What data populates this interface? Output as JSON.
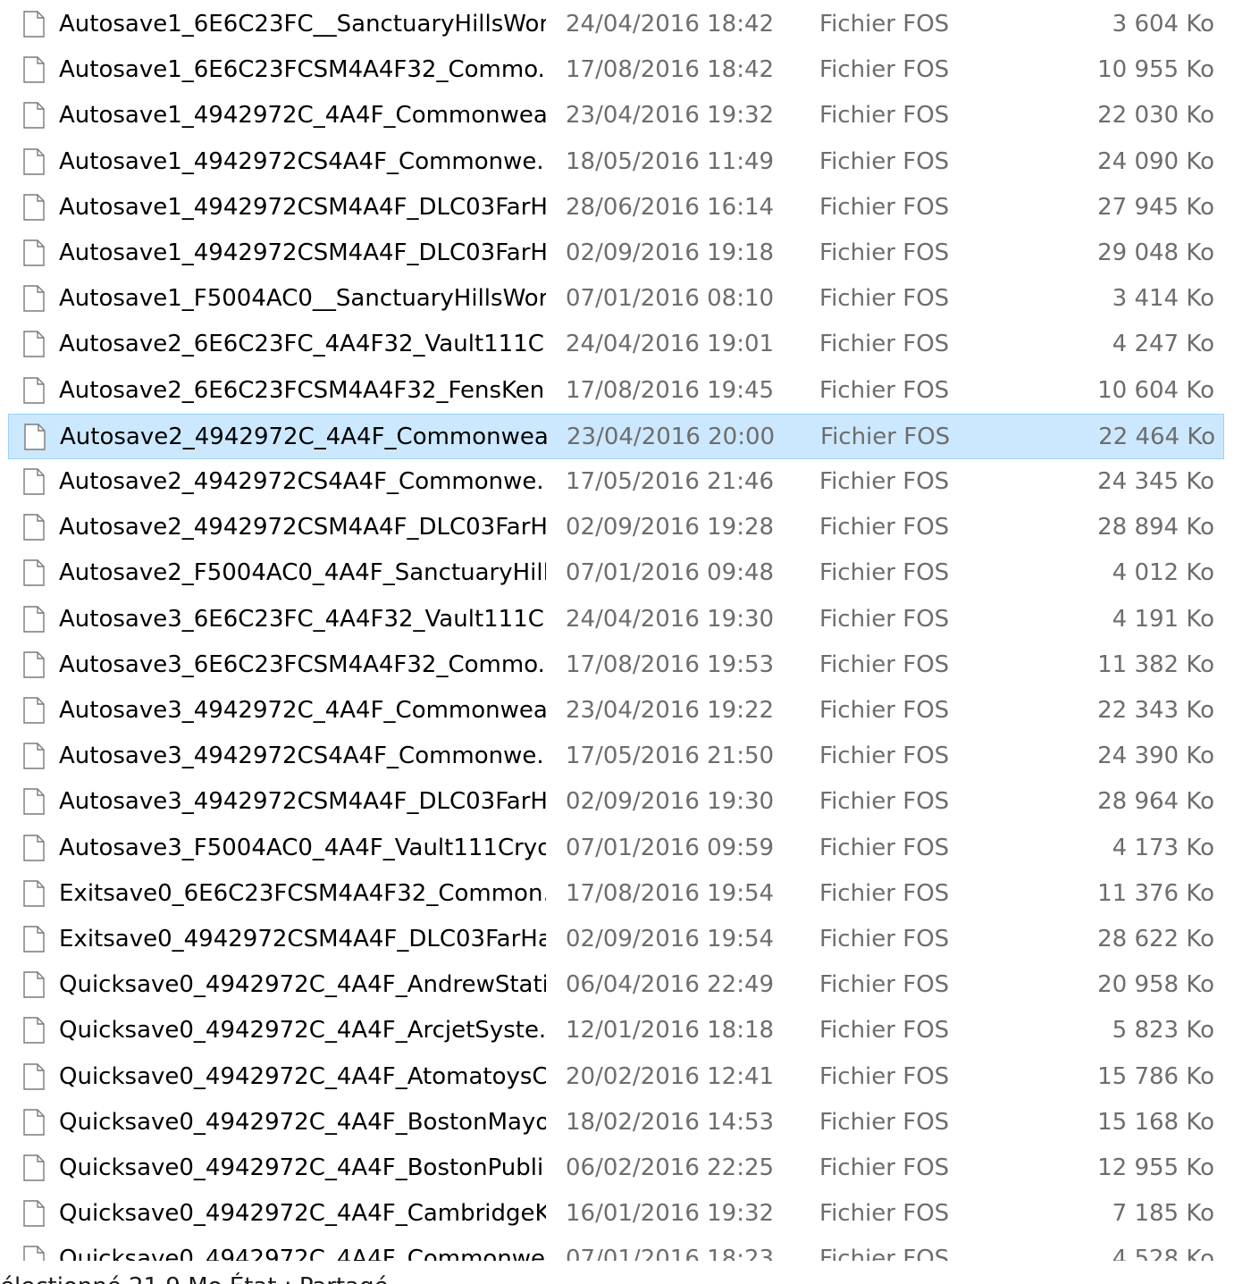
{
  "file_list": {
    "selected_index": 9,
    "rows": [
      {
        "name": "Autosave1_6E6C23FC__SanctuaryHillsWor...",
        "date": "24/04/2016 18:42",
        "type": "Fichier FOS",
        "size": "3 604 Ko"
      },
      {
        "name": "Autosave1_6E6C23FCSM4A4F32_Commo...",
        "date": "17/08/2016 18:42",
        "type": "Fichier FOS",
        "size": "10 955 Ko"
      },
      {
        "name": "Autosave1_4942972C_4A4F_Commonwea...",
        "date": "23/04/2016 19:32",
        "type": "Fichier FOS",
        "size": "22 030 Ko"
      },
      {
        "name": "Autosave1_4942972CS4A4F_Commonwe...",
        "date": "18/05/2016 11:49",
        "type": "Fichier FOS",
        "size": "24 090 Ko"
      },
      {
        "name": "Autosave1_4942972CSM4A4F_DLC03FarH...",
        "date": "28/06/2016 16:14",
        "type": "Fichier FOS",
        "size": "27 945 Ko"
      },
      {
        "name": "Autosave1_4942972CSM4A4F_DLC03FarH...",
        "date": "02/09/2016 19:18",
        "type": "Fichier FOS",
        "size": "29 048 Ko"
      },
      {
        "name": "Autosave1_F5004AC0__SanctuaryHillsWor...",
        "date": "07/01/2016 08:10",
        "type": "Fichier FOS",
        "size": "3 414 Ko"
      },
      {
        "name": "Autosave2_6E6C23FC_4A4F32_Vault111Cr...",
        "date": "24/04/2016 19:01",
        "type": "Fichier FOS",
        "size": "4 247 Ko"
      },
      {
        "name": "Autosave2_6E6C23FCSM4A4F32_FensKen...",
        "date": "17/08/2016 19:45",
        "type": "Fichier FOS",
        "size": "10 604 Ko"
      },
      {
        "name": "Autosave2_4942972C_4A4F_Commonwea...",
        "date": "23/04/2016 20:00",
        "type": "Fichier FOS",
        "size": "22 464 Ko"
      },
      {
        "name": "Autosave2_4942972CS4A4F_Commonwe...",
        "date": "17/05/2016 21:46",
        "type": "Fichier FOS",
        "size": "24 345 Ko"
      },
      {
        "name": "Autosave2_4942972CSM4A4F_DLC03FarH...",
        "date": "02/09/2016 19:28",
        "type": "Fichier FOS",
        "size": "28 894 Ko"
      },
      {
        "name": "Autosave2_F5004AC0_4A4F_SanctuaryHill...",
        "date": "07/01/2016 09:48",
        "type": "Fichier FOS",
        "size": "4 012 Ko"
      },
      {
        "name": "Autosave3_6E6C23FC_4A4F32_Vault111Cr...",
        "date": "24/04/2016 19:30",
        "type": "Fichier FOS",
        "size": "4 191 Ko"
      },
      {
        "name": "Autosave3_6E6C23FCSM4A4F32_Commo...",
        "date": "17/08/2016 19:53",
        "type": "Fichier FOS",
        "size": "11 382 Ko"
      },
      {
        "name": "Autosave3_4942972C_4A4F_Commonwea...",
        "date": "23/04/2016 19:22",
        "type": "Fichier FOS",
        "size": "22 343 Ko"
      },
      {
        "name": "Autosave3_4942972CS4A4F_Commonwe...",
        "date": "17/05/2016 21:50",
        "type": "Fichier FOS",
        "size": "24 390 Ko"
      },
      {
        "name": "Autosave3_4942972CSM4A4F_DLC03FarH...",
        "date": "02/09/2016 19:30",
        "type": "Fichier FOS",
        "size": "28 964 Ko"
      },
      {
        "name": "Autosave3_F5004AC0_4A4F_Vault111Cryo...",
        "date": "07/01/2016 09:59",
        "type": "Fichier FOS",
        "size": "4 173 Ko"
      },
      {
        "name": "Exitsave0_6E6C23FCSM4A4F32_Common...",
        "date": "17/08/2016 19:54",
        "type": "Fichier FOS",
        "size": "11 376 Ko"
      },
      {
        "name": "Exitsave0_4942972CSM4A4F_DLC03FarHa...",
        "date": "02/09/2016 19:54",
        "type": "Fichier FOS",
        "size": "28 622 Ko"
      },
      {
        "name": "Quicksave0_4942972C_4A4F_AndrewStati...",
        "date": "06/04/2016 22:49",
        "type": "Fichier FOS",
        "size": "20 958 Ko"
      },
      {
        "name": "Quicksave0_4942972C_4A4F_ArcjetSyste...",
        "date": "12/01/2016 18:18",
        "type": "Fichier FOS",
        "size": "5 823 Ko"
      },
      {
        "name": "Quicksave0_4942972C_4A4F_AtomatoysC...",
        "date": "20/02/2016 12:41",
        "type": "Fichier FOS",
        "size": "15 786 Ko"
      },
      {
        "name": "Quicksave0_4942972C_4A4F_BostonMayo...",
        "date": "18/02/2016 14:53",
        "type": "Fichier FOS",
        "size": "15 168 Ko"
      },
      {
        "name": "Quicksave0_4942972C_4A4F_BostonPubli...",
        "date": "06/02/2016 22:25",
        "type": "Fichier FOS",
        "size": "12 955 Ko"
      },
      {
        "name": "Quicksave0_4942972C_4A4F_CambridgeK...",
        "date": "16/01/2016 19:32",
        "type": "Fichier FOS",
        "size": "7 185 Ko"
      },
      {
        "name": "Quicksave0_4942972C_4A4F_Commonwe...",
        "date": "07/01/2016 18:23",
        "type": "Fichier FOS",
        "size": "4 528 Ko"
      }
    ]
  },
  "icons": {
    "file": "document-icon"
  },
  "colors": {
    "selection_bg": "#cce8ff",
    "selection_border": "#99d1ff",
    "secondary_text": "#6d6d6d"
  },
  "status_bar": {
    "text": "électionné 21,9 Mo    État :  Partagé"
  }
}
